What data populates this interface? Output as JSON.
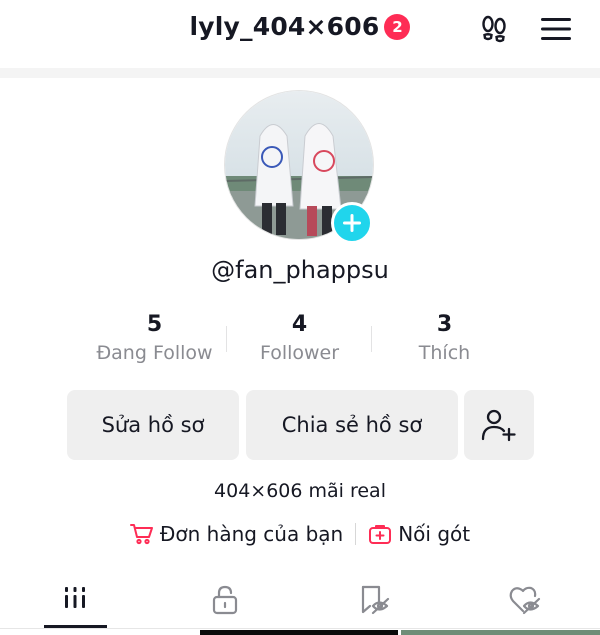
{
  "header": {
    "title": "lyly_404×606",
    "badge_count": "2"
  },
  "profile": {
    "handle": "@fan_phappsu",
    "bio": "404×606 mãi real"
  },
  "stats": [
    {
      "value": "5",
      "label": "Đang Follow"
    },
    {
      "value": "4",
      "label": "Follower"
    },
    {
      "value": "3",
      "label": "Thích"
    }
  ],
  "buttons": {
    "edit_profile": "Sửa hồ sơ",
    "share_profile": "Chia sẻ hồ sơ"
  },
  "links": {
    "orders": "Đơn hàng của bạn",
    "continue": "Nối gót"
  },
  "tabs": [
    {
      "name": "videos",
      "icon": "grid-icon",
      "active": true
    },
    {
      "name": "private",
      "icon": "lock-icon",
      "active": false
    },
    {
      "name": "saved",
      "icon": "bookmark-hidden-icon",
      "active": false
    },
    {
      "name": "liked",
      "icon": "heart-hidden-icon",
      "active": false
    }
  ],
  "colors": {
    "accent": "#fe2c55",
    "avatar_add": "#20d5ec",
    "text": "#161823",
    "muted": "#8a8b91",
    "button_bg": "#efefef"
  }
}
